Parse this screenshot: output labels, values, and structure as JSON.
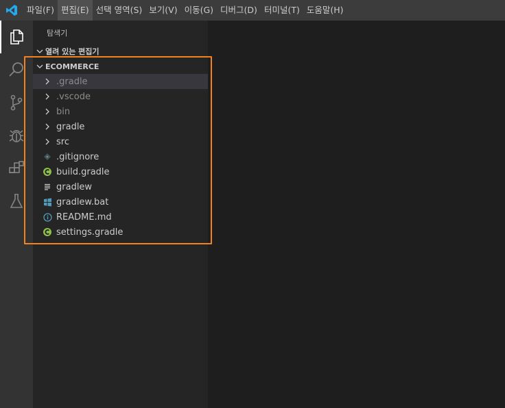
{
  "menubar": {
    "logo_icon": "vscode-logo-icon",
    "items": [
      {
        "label": "파일(F)",
        "active": false
      },
      {
        "label": "편집(E)",
        "active": true
      },
      {
        "label": "선택 영역(S)",
        "active": false
      },
      {
        "label": "보기(V)",
        "active": false
      },
      {
        "label": "이동(G)",
        "active": false
      },
      {
        "label": "디버그(D)",
        "active": false
      },
      {
        "label": "터미널(T)",
        "active": false
      },
      {
        "label": "도움말(H)",
        "active": false
      }
    ]
  },
  "activity_bar": {
    "items": [
      "explorer-icon",
      "search-icon",
      "source-control-icon",
      "debug-icon",
      "extensions-icon",
      "testing-flask-icon"
    ],
    "active": "explorer-icon"
  },
  "sidebar": {
    "title": "탐색기",
    "open_editors_label": "열려 있는 편집기",
    "folder_label": "ECOMMERCE",
    "tree": [
      {
        "label": ".gradle",
        "kind": "folder",
        "dim": true,
        "selected": true
      },
      {
        "label": ".vscode",
        "kind": "folder",
        "dim": true,
        "selected": false
      },
      {
        "label": "bin",
        "kind": "folder",
        "dim": true,
        "selected": false
      },
      {
        "label": "gradle",
        "kind": "folder",
        "dim": false,
        "selected": false
      },
      {
        "label": "src",
        "kind": "folder",
        "dim": false,
        "selected": false
      },
      {
        "label": ".gitignore",
        "kind": "git",
        "dim": false,
        "selected": false
      },
      {
        "label": "build.gradle",
        "kind": "gradle",
        "dim": false,
        "selected": false
      },
      {
        "label": "gradlew",
        "kind": "text",
        "dim": false,
        "selected": false
      },
      {
        "label": "gradlew.bat",
        "kind": "windows",
        "dim": false,
        "selected": false
      },
      {
        "label": "README.md",
        "kind": "info",
        "dim": false,
        "selected": false
      },
      {
        "label": "settings.gradle",
        "kind": "gradle",
        "dim": false,
        "selected": false
      }
    ]
  },
  "colors": {
    "highlight": "#f5821f",
    "vscode_blue": "#23a9f2",
    "gradle_green": "#8dc149",
    "info_blue": "#519aba"
  }
}
